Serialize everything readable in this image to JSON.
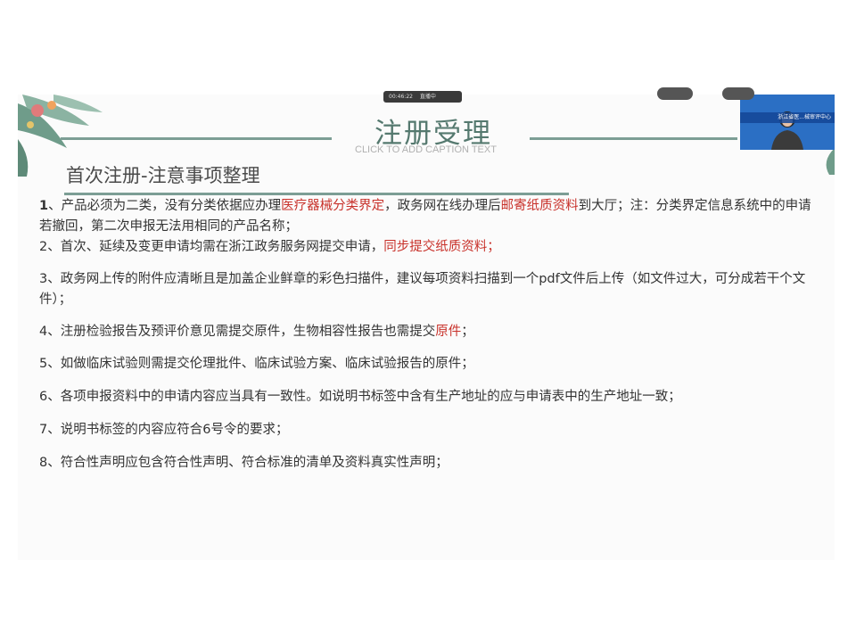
{
  "slide": {
    "title": "注册受理",
    "caption_placeholder": "CLICK TO ADD CAPTION TEXT",
    "subtitle": "首次注册-注意事项整理"
  },
  "overlay": {
    "live_time": "00:46:22",
    "live_status": "直播中",
    "video_banner": "浙江省医...械审评中心"
  },
  "items": [
    {
      "segments": [
        {
          "text": "1",
          "style": "num"
        },
        {
          "text": "、产品必须为二类，没有分类依据应办理",
          "style": "normal"
        },
        {
          "text": "医疗器械分类界定",
          "style": "red"
        },
        {
          "text": "，政务网在线办理后",
          "style": "normal"
        },
        {
          "text": "邮寄纸质资料",
          "style": "red"
        },
        {
          "text": "到大厅；注：分类界定信息系统中的申请若撤回，第二次申报无法用相同的产品名称；",
          "style": "normal"
        }
      ]
    },
    {
      "segments": [
        {
          "text": "2、首次、延续及变更申请均需在浙江政务服务网提交申请，",
          "style": "normal"
        },
        {
          "text": "同步提交纸质资料；",
          "style": "red"
        }
      ]
    },
    {
      "segments": [
        {
          "text": "3、政务网上传的附件应清晰且是加盖企业鲜章的彩色扫描件，建议每项资料扫描到一个pdf文件后上传（如文件过大，可分成若干个文件）；",
          "style": "normal"
        }
      ]
    },
    {
      "segments": [
        {
          "text": "4、注册检验报告及预评价意见需提交原件，生物相容性报告也需提交",
          "style": "normal"
        },
        {
          "text": "原件",
          "style": "red"
        },
        {
          "text": "；",
          "style": "normal"
        }
      ]
    },
    {
      "segments": [
        {
          "text": "5、如做临床试验则需提交伦理批件、临床试验方案、临床试验报告的原件；",
          "style": "normal"
        }
      ]
    },
    {
      "segments": [
        {
          "text": "6、各项申报资料中的申请内容应当具有一致性。如说明书标签中含有生产地址的应与申请表中的生产地址一致；",
          "style": "normal"
        }
      ]
    },
    {
      "segments": [
        {
          "text": "7、说明书标签的内容应符合6号令的要求；",
          "style": "normal"
        }
      ]
    },
    {
      "segments": [
        {
          "text": "8、符合性声明应包含符合性声明、符合标准的清单及资料真实性声明；",
          "style": "normal"
        }
      ]
    }
  ],
  "colors": {
    "accent": "#7c9e95",
    "highlight": "#c8312a",
    "title": "#55796f"
  }
}
